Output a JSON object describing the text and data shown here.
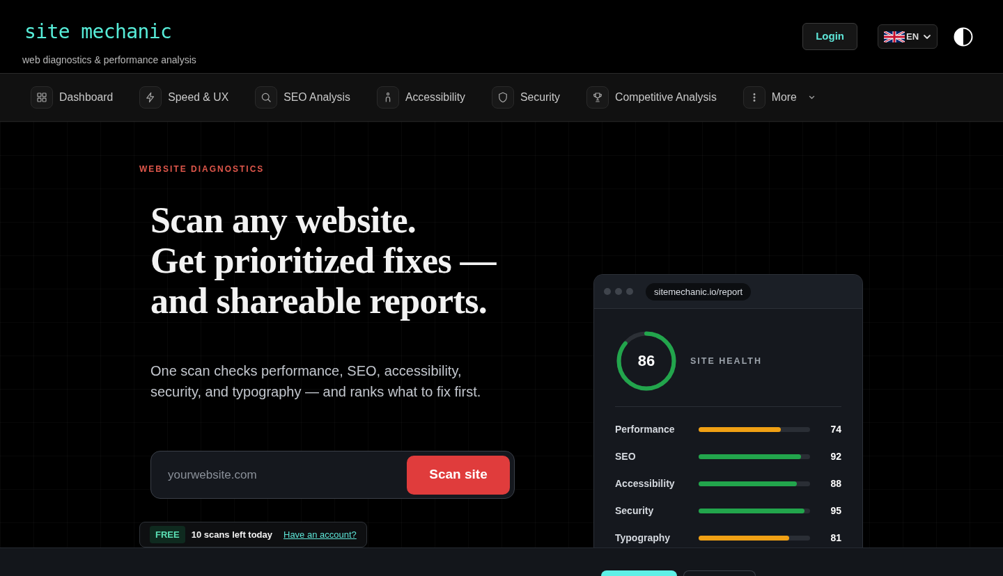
{
  "header": {
    "logo": "site mechanic",
    "tagline": "web diagnostics & performance analysis",
    "login_button": "Login",
    "language": {
      "code": "EN"
    }
  },
  "nav": {
    "items": [
      {
        "label": "Dashboard",
        "kind": "link"
      },
      {
        "label": "Speed & UX",
        "kind": "link"
      },
      {
        "label": "SEO Analysis",
        "kind": "link"
      },
      {
        "label": "Accessibility",
        "kind": "link"
      },
      {
        "label": "Security",
        "kind": "link"
      },
      {
        "label": "Competitive Analysis",
        "kind": "link"
      },
      {
        "label": "More",
        "kind": "dropdown"
      }
    ]
  },
  "hero": {
    "eyebrow": "WEBSITE DIAGNOSTICS",
    "heading_lines": [
      "Scan any website.",
      "Get prioritized fixes —",
      "and shareable reports."
    ],
    "description": "One scan checks performance, SEO, accessibility, security, and typography — and ranks what to fix first.",
    "scan_form": {
      "placeholder": "yourwebsite.com",
      "button": "Scan site"
    },
    "quota": {
      "badge": "FREE",
      "text": "10 scans left today",
      "link": "Have an account?"
    }
  },
  "report": {
    "url": "sitemechanic.io/report",
    "health": {
      "score": "86",
      "level": 0.86,
      "label": "SITE HEALTH"
    },
    "metrics": [
      {
        "name": "Performance",
        "value": "74",
        "level": 0.74,
        "color": "#f0a014"
      },
      {
        "name": "SEO",
        "value": "92",
        "level": 0.92,
        "color": "#22a54c"
      },
      {
        "name": "Accessibility",
        "value": "88",
        "level": 0.88,
        "color": "#22a54c"
      },
      {
        "name": "Security",
        "value": "95",
        "level": 0.95,
        "color": "#22a54c"
      },
      {
        "name": "Typography",
        "value": "81",
        "level": 0.81,
        "color": "#f0a014"
      }
    ]
  },
  "bottom_bar": {
    "buttons": [
      {
        "kind": "primary"
      },
      {
        "kind": "outline"
      }
    ]
  }
}
